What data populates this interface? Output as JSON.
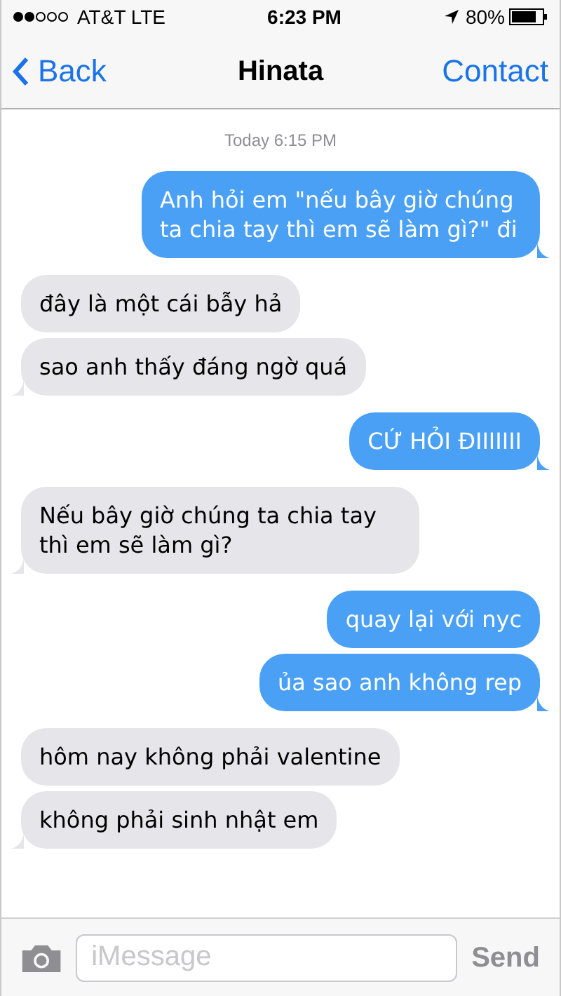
{
  "status_bar": {
    "carrier": "AT&T LTE",
    "time": "6:23 PM",
    "battery": "80%"
  },
  "nav": {
    "back": "Back",
    "title": "Hinata",
    "action": "Contact"
  },
  "timestamp": "Today 6:15 PM",
  "messages": [
    {
      "kind": "sent",
      "text": "Anh hỏi em \"nếu bây giờ chúng ta chia tay thì em sẽ làm gì?\" đi",
      "tail": true
    },
    {
      "kind": "received",
      "text": "đây là một cái bẫy hả",
      "tail": false
    },
    {
      "kind": "received",
      "text": "sao anh thấy đáng ngờ quá",
      "tail": true
    },
    {
      "kind": "sent",
      "text": "CỨ HỎI ĐIIIIIII",
      "tail": true
    },
    {
      "kind": "received",
      "text": "Nếu bây giờ chúng ta chia tay thì em sẽ làm gì?",
      "tail": true
    },
    {
      "kind": "sent",
      "text": "quay lại với nyc",
      "tail": false
    },
    {
      "kind": "sent",
      "text": "ủa sao anh không rep",
      "tail": true
    },
    {
      "kind": "received",
      "text": "hôm nay không phải valentine",
      "tail": false
    },
    {
      "kind": "received",
      "text": "không phải sinh nhật em",
      "tail": true
    }
  ],
  "composer": {
    "placeholder": "iMessage",
    "send": "Send"
  }
}
